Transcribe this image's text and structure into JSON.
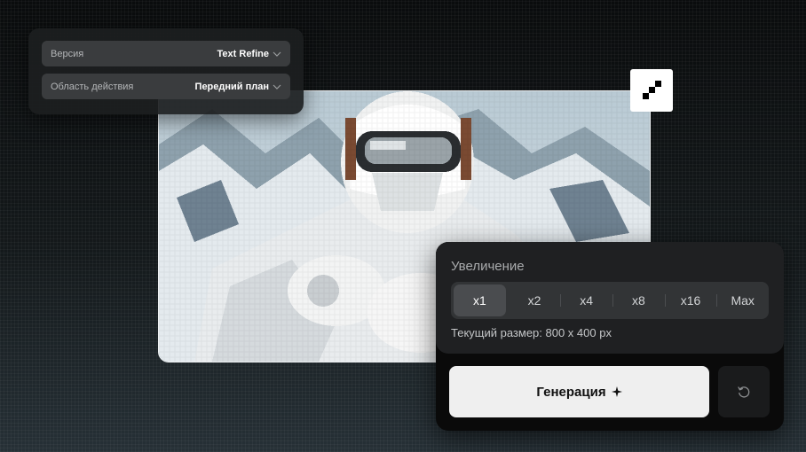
{
  "settings": {
    "version_label": "Версия",
    "version_value": "Text Refine",
    "scope_label": "Область действия",
    "scope_value": "Передний план"
  },
  "upscale": {
    "title": "Увеличение",
    "options": [
      "x1",
      "x2",
      "x4",
      "x8",
      "x16",
      "Max"
    ],
    "selected": "x1",
    "current_size": "Текущий размер: 800 x 400 px"
  },
  "actions": {
    "generate_label": "Генерация",
    "generate_icon": "sparkle-icon",
    "reset_icon": "reset-icon"
  },
  "image": {
    "subject": "pixelated skier in white suit with goggles",
    "badge_icon": "pixelate-icon"
  }
}
